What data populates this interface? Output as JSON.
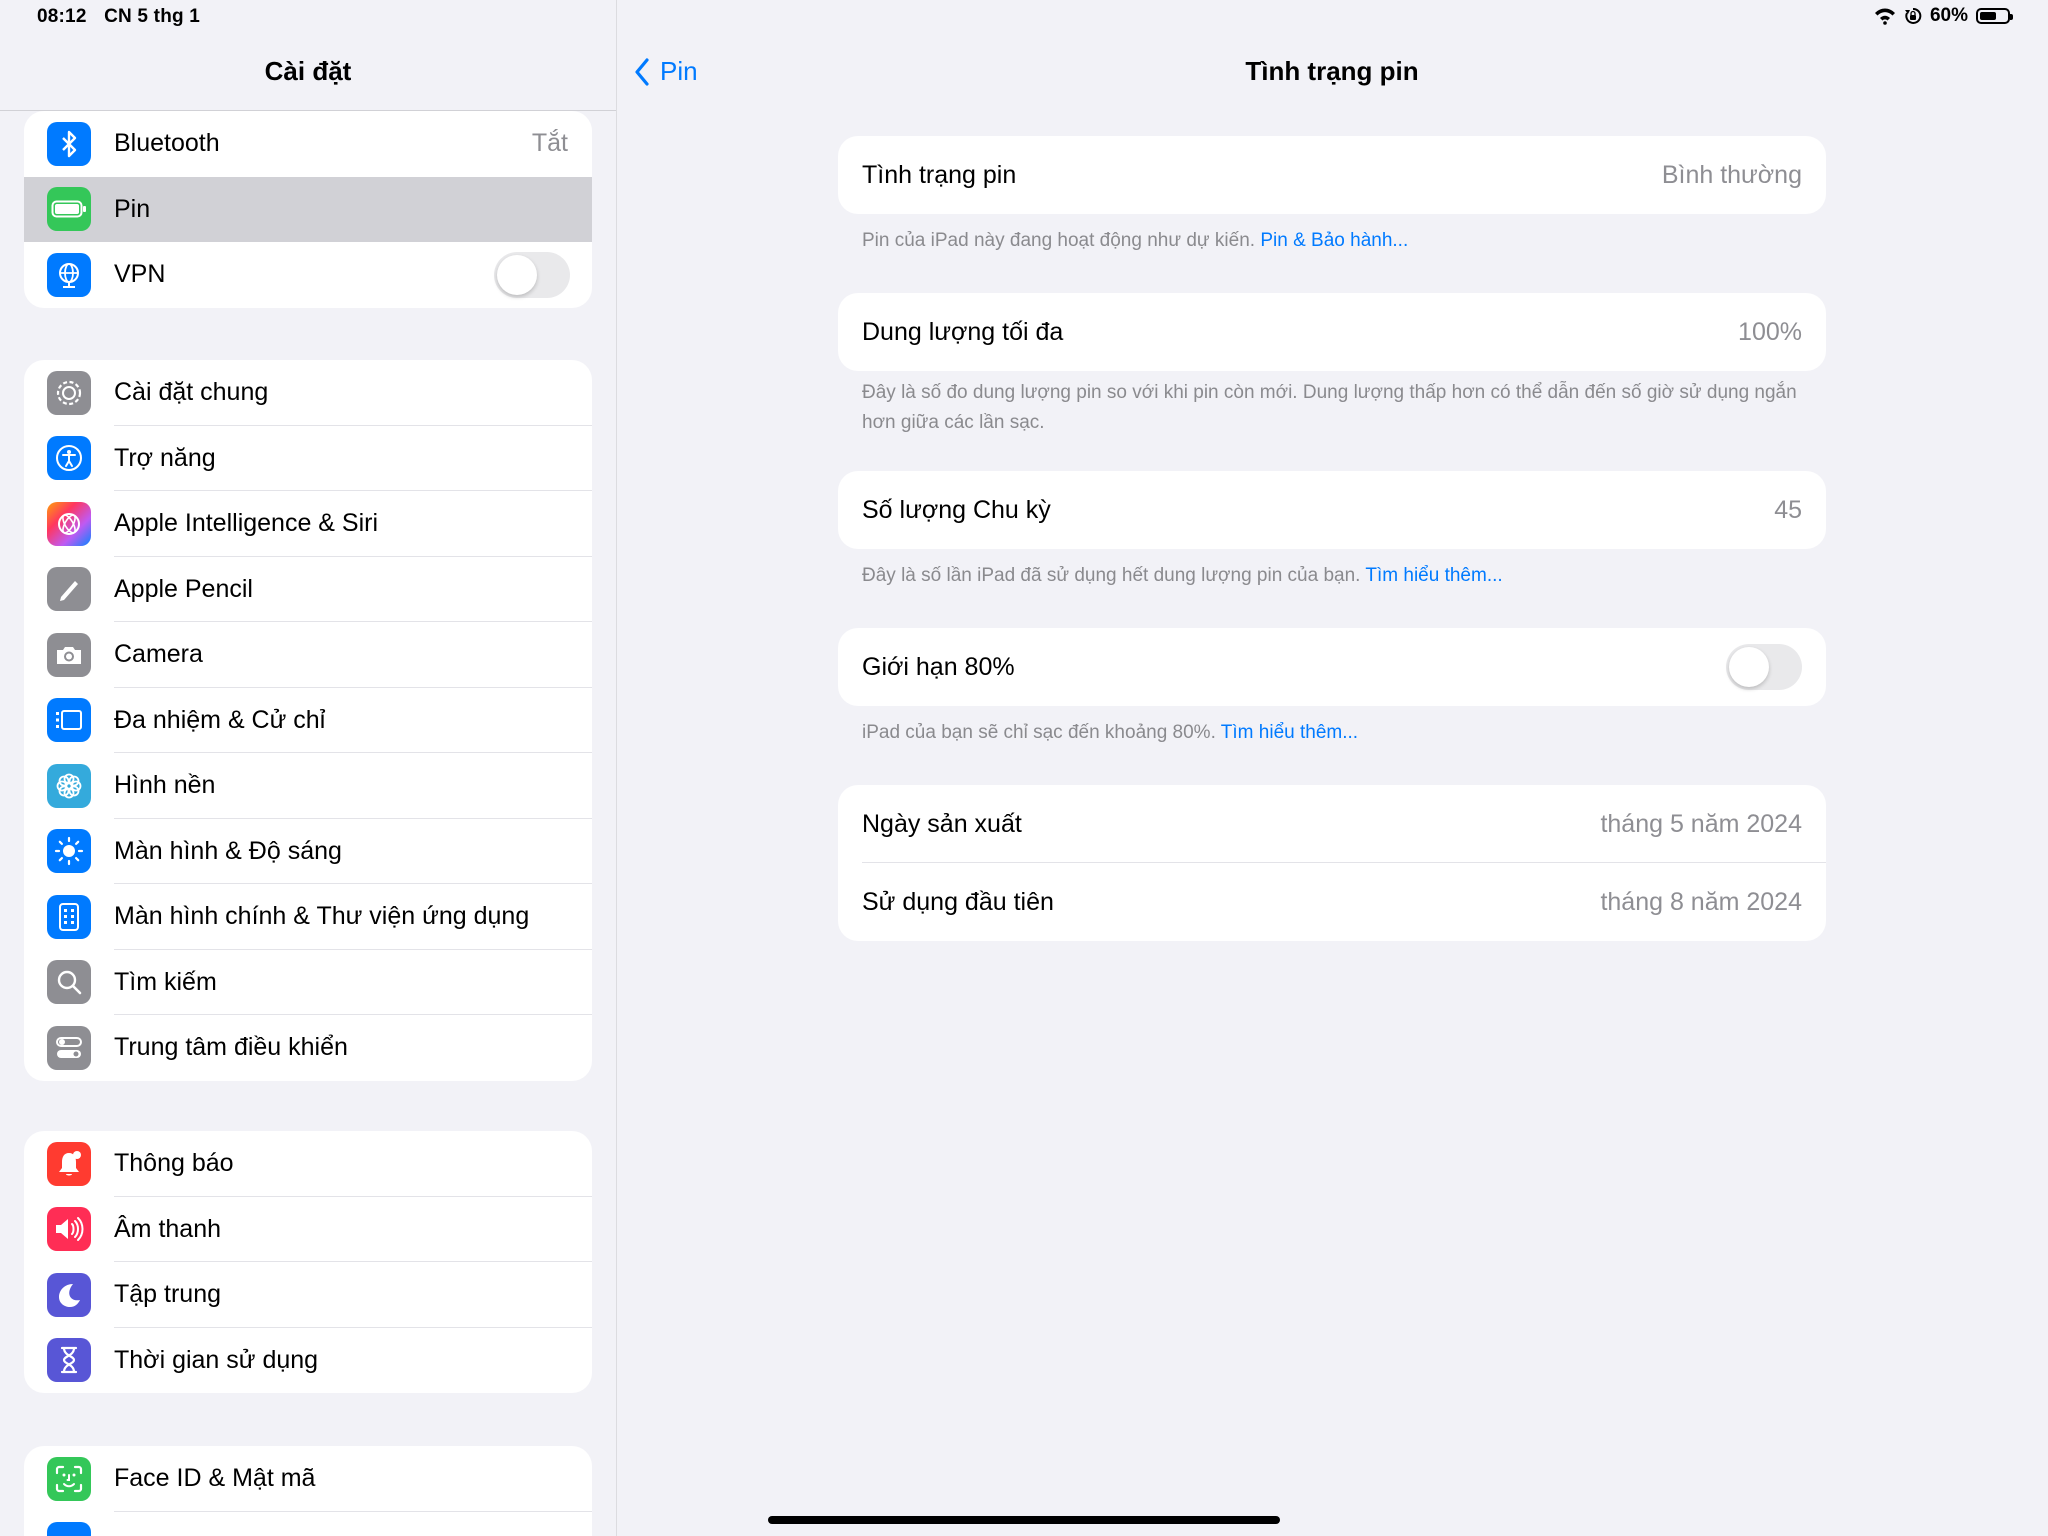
{
  "status_bar": {
    "time": "08:12",
    "date": "CN 5 thg 1",
    "battery_percent": "60%",
    "battery_level": 0.6
  },
  "sidebar": {
    "title": "Cài đặt",
    "groups": [
      {
        "items": [
          {
            "label": "Bluetooth",
            "value": "Tắt",
            "icon": "bluetooth-icon",
            "color": "#007aff"
          },
          {
            "label": "Pin",
            "icon": "battery-icon",
            "color": "#34c759",
            "selected": true
          },
          {
            "label": "VPN",
            "icon": "globe-icon",
            "color": "#007aff",
            "toggle": false
          }
        ]
      },
      {
        "items": [
          {
            "label": "Cài đặt chung",
            "icon": "gear-icon",
            "color": "#8e8e93"
          },
          {
            "label": "Trợ năng",
            "icon": "accessibility-icon",
            "color": "#007aff"
          },
          {
            "label": "Apple Intelligence & Siri",
            "icon": "siri-icon",
            "color": "#ff6b6b"
          },
          {
            "label": "Apple Pencil",
            "icon": "pencil-icon",
            "color": "#8e8e93"
          },
          {
            "label": "Camera",
            "icon": "camera-icon",
            "color": "#8e8e93"
          },
          {
            "label": "Đa nhiệm & Cử chỉ",
            "icon": "multitasking-icon",
            "color": "#007aff"
          },
          {
            "label": "Hình nền",
            "icon": "flower-icon",
            "color": "#34aadc"
          },
          {
            "label": "Màn hình & Độ sáng",
            "icon": "sun-icon",
            "color": "#007aff"
          },
          {
            "label": "Màn hình chính & Thư viện ứng dụng",
            "icon": "home-screen-icon",
            "color": "#007aff"
          },
          {
            "label": "Tìm kiếm",
            "icon": "search-icon",
            "color": "#8e8e93"
          },
          {
            "label": "Trung tâm điều khiển",
            "icon": "control-center-icon",
            "color": "#8e8e93"
          }
        ]
      },
      {
        "items": [
          {
            "label": "Thông báo",
            "icon": "bell-icon",
            "color": "#ff3b30"
          },
          {
            "label": "Âm thanh",
            "icon": "speaker-icon",
            "color": "#ff2d55"
          },
          {
            "label": "Tập trung",
            "icon": "moon-icon",
            "color": "#5856d6"
          },
          {
            "label": "Thời gian sử dụng",
            "icon": "hourglass-icon",
            "color": "#5856d6"
          }
        ]
      },
      {
        "items": [
          {
            "label": "Face ID & Mật mã",
            "icon": "faceid-icon",
            "color": "#34c759"
          }
        ]
      }
    ]
  },
  "detail": {
    "back_label": "Pin",
    "title": "Tình trạng pin",
    "sections": [
      {
        "rows": [
          {
            "label": "Tình trạng pin",
            "value": "Bình thường"
          }
        ],
        "footer": "Pin của iPad này đang hoạt động như dự kiến.",
        "footer_link": "Pin & Bảo hành..."
      },
      {
        "rows": [
          {
            "label": "Dung lượng tối đa",
            "value": "100%"
          }
        ],
        "footer": "Đây là số đo dung lượng pin so với khi pin còn mới. Dung lượng thấp hơn có thể dẫn đến số giờ sử dụng ngắn hơn giữa các lần sạc."
      },
      {
        "rows": [
          {
            "label": "Số lượng Chu kỳ",
            "value": "45"
          }
        ],
        "footer": "Đây là số lần iPad đã sử dụng hết dung lượng pin của bạn.",
        "footer_link": "Tìm hiểu thêm..."
      },
      {
        "rows": [
          {
            "label": "Giới hạn 80%",
            "toggle": false
          }
        ],
        "footer": "iPad của bạn sẽ chỉ sạc đến khoảng 80%.",
        "footer_link": "Tìm hiểu thêm..."
      },
      {
        "rows": [
          {
            "label": "Ngày sản xuất",
            "value": "tháng 5 năm 2024"
          },
          {
            "label": "Sử dụng đầu tiên",
            "value": "tháng 8 năm 2024"
          }
        ]
      }
    ]
  }
}
